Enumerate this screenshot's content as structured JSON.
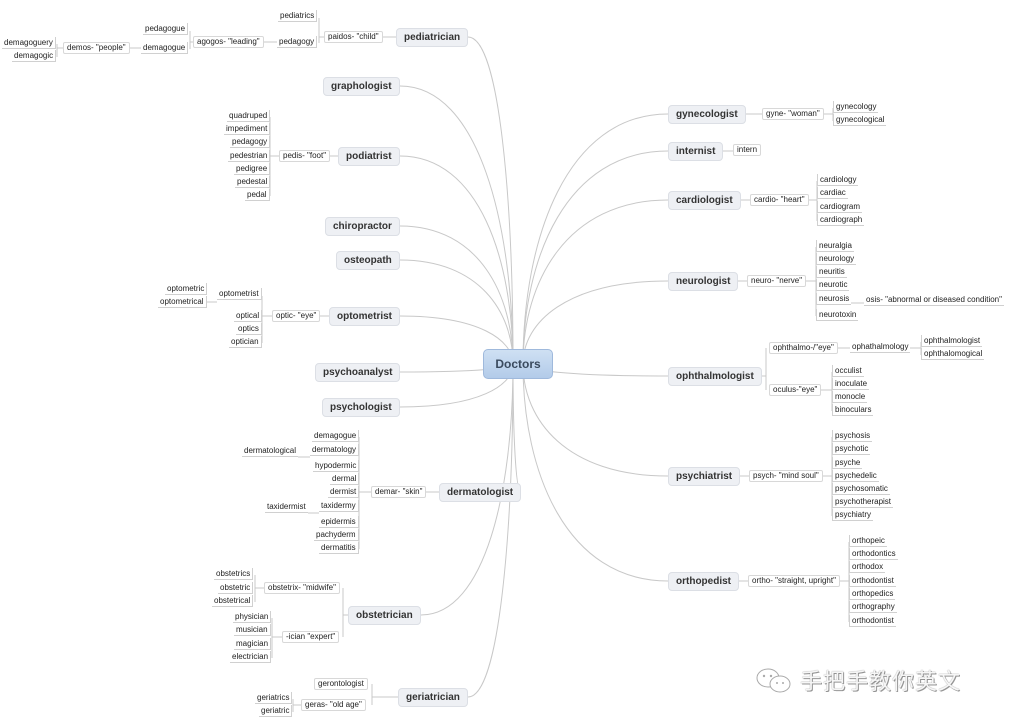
{
  "root": "Doctors",
  "left": [
    {
      "label": "pediatrician",
      "roots": [
        {
          "label": "paidos- \"child\"",
          "words": [
            "pediatrics",
            "pedagogy"
          ],
          "sub": {
            "of": "pedagogy",
            "label": "agogos- \"leading\"",
            "words": [
              "pedagogue",
              "demagogue"
            ],
            "sub": {
              "of": "demagogue",
              "label": "demos- \"people\"",
              "words": [
                "demagoguery",
                "demagogic"
              ]
            }
          }
        }
      ]
    },
    {
      "label": "graphologist"
    },
    {
      "label": "podiatrist",
      "roots": [
        {
          "label": "pedis- \"foot\"",
          "words": [
            "quadruped",
            "impediment",
            "pedagogy",
            "pedestrian",
            "pedigree",
            "pedestal",
            "pedal"
          ]
        }
      ]
    },
    {
      "label": "chiropractor"
    },
    {
      "label": "osteopath"
    },
    {
      "label": "optometrist",
      "roots": [
        {
          "label": "optic- \"eye\"",
          "words": [
            "optometrist",
            "optical",
            "optics",
            "optician"
          ],
          "extra": {
            "of": "optometrist",
            "words": [
              "optometric",
              "optometrical"
            ]
          }
        }
      ]
    },
    {
      "label": "psychoanalyst"
    },
    {
      "label": "psychologist"
    },
    {
      "label": "dermatologist",
      "roots": [
        {
          "label": "demar- \"skin\"",
          "words": [
            "demagogue",
            "dermatology",
            "hypodermic",
            "dermal",
            "dermist",
            "taxidermy",
            "epidermis",
            "pachyderm",
            "dermatitis"
          ],
          "extras": [
            {
              "of": "dermatology",
              "word": "dermatological"
            },
            {
              "of": "taxidermy",
              "word": "taxidermist"
            }
          ]
        }
      ]
    },
    {
      "label": "obstetrician",
      "roots": [
        {
          "label": "obstetrix- \"midwife\"",
          "words": [
            "obstetrics",
            "obstetric",
            "obstetrical"
          ]
        },
        {
          "label": "-ician \"expert\"",
          "words": [
            "physician",
            "musician",
            "magician",
            "electrician"
          ]
        }
      ]
    },
    {
      "label": "geriatrician",
      "roots": [
        {
          "label": "gerontologist",
          "words": []
        },
        {
          "label": "geras- \"old age\"",
          "words": [
            "geriatrics",
            "geriatric"
          ]
        }
      ]
    }
  ],
  "right": [
    {
      "label": "gynecologist",
      "roots": [
        {
          "label": "gyne- \"woman\"",
          "words": [
            "gynecology",
            "gynecological"
          ]
        }
      ]
    },
    {
      "label": "internist",
      "roots": [
        {
          "label": "intern",
          "words": []
        }
      ]
    },
    {
      "label": "cardiologist",
      "roots": [
        {
          "label": "cardio- \"heart\"",
          "words": [
            "cardiology",
            "cardiac",
            "cardiogram",
            "cardiograph"
          ]
        }
      ]
    },
    {
      "label": "neurologist",
      "roots": [
        {
          "label": "neuro- \"nerve\"",
          "words": [
            "neuralgia",
            "neurology",
            "neuritis",
            "neurotic",
            "neurosis",
            "neurotoxin"
          ],
          "extra": {
            "of": "neurosis",
            "label": "osis- \"abnormal or diseased condition\""
          }
        }
      ]
    },
    {
      "label": "ophthalmologist",
      "roots": [
        {
          "label": "ophthalmo-/\"eye\"",
          "words": [
            "ophathalmology"
          ],
          "sub": {
            "label": "ophathalmology",
            "words": [
              "ophthalmologist",
              "ophthalomogical"
            ]
          }
        },
        {
          "label": "oculus-\"eye\"",
          "words": [
            "occulist",
            "inoculate",
            "monocle",
            "binoculars"
          ]
        }
      ]
    },
    {
      "label": "psychiatrist",
      "roots": [
        {
          "label": "psych- \"mind soul\"",
          "words": [
            "psychosis",
            "psychotic",
            "psyche",
            "psychedelic",
            "psychosomatic",
            "psychotherapist",
            "psychiatry"
          ]
        }
      ]
    },
    {
      "label": "orthopedist",
      "roots": [
        {
          "label": "ortho- \"straight, upright\"",
          "words": [
            "orthopeic",
            "orthodontics",
            "orthodox",
            "orthodontist",
            "orthopedics",
            "orthography",
            "orthodontist"
          ]
        }
      ]
    }
  ],
  "watermark": "手把手教你英文",
  "colors": {
    "link": "#c8c8c8",
    "root_fill": "#c3d6ee",
    "node_fill": "#eef0f4"
  }
}
